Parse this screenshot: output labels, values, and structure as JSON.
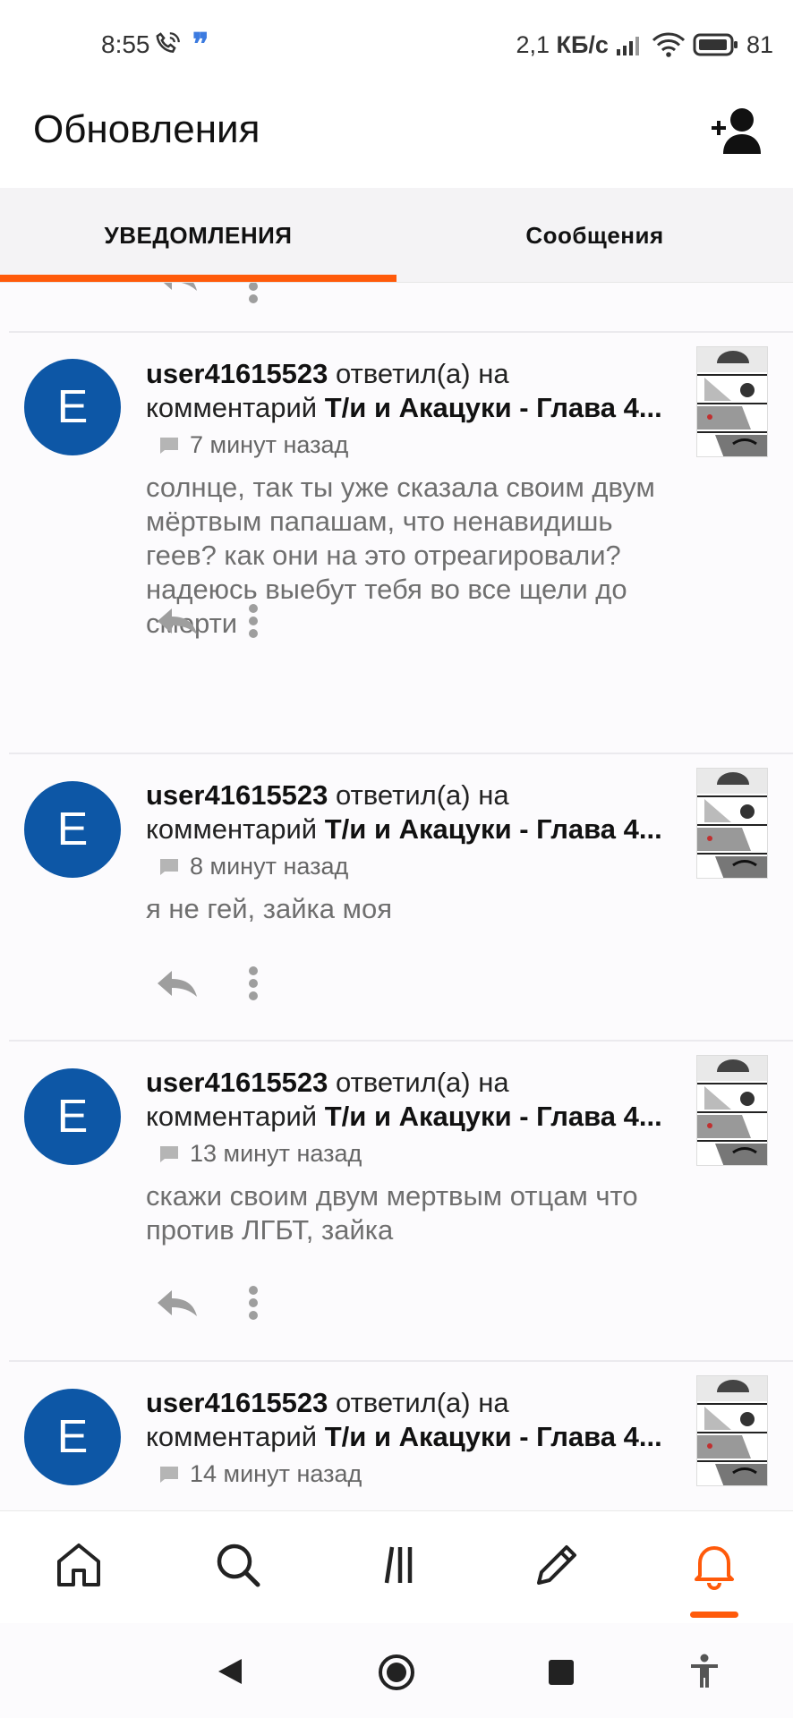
{
  "status_bar": {
    "time": "8:55",
    "network_speed_value": "2,1",
    "network_speed_unit": "КБ/с",
    "battery_percent": "81"
  },
  "header": {
    "title": "Обновления"
  },
  "tabs": [
    {
      "label": "УВЕДОМЛЕНИЯ",
      "active": true
    },
    {
      "label": "Сообщения",
      "active": false
    }
  ],
  "notifications": [
    {
      "avatar_letter": "E",
      "username": "user41615523",
      "action": " ответил(а) на",
      "target_prefix": "комментарий ",
      "story": "Т/и и Акацуки - Глава 4...",
      "time": "7 минут назад",
      "text": "солнце, так ты уже сказала своим двум мёртвым папашам, что ненавидишь геев? как они на это отреагировали? надеюсь выебут тебя во все щели до смерти"
    },
    {
      "avatar_letter": "E",
      "username": "user41615523",
      "action": " ответил(а) на",
      "target_prefix": "комментарий ",
      "story": "Т/и и Акацуки - Глава 4...",
      "time": "8 минут назад",
      "text": "я не гей, зайка моя"
    },
    {
      "avatar_letter": "E",
      "username": "user41615523",
      "action": " ответил(а) на",
      "target_prefix": "комментарий ",
      "story": "Т/и и Акацуки - Глава 4...",
      "time": "13 минут назад",
      "text": "скажи своим двум мертвым отцам что против ЛГБТ, зайка"
    },
    {
      "avatar_letter": "E",
      "username": "user41615523",
      "action": " ответил(а) на",
      "target_prefix": "комментарий ",
      "story": "Т/и и Акацуки - Глава 4...",
      "time": "14 минут назад",
      "text": ""
    }
  ],
  "bottom_nav": [
    {
      "icon": "home-icon",
      "active": false
    },
    {
      "icon": "search-icon",
      "active": false
    },
    {
      "icon": "library-icon",
      "active": false
    },
    {
      "icon": "pencil-icon",
      "active": false
    },
    {
      "icon": "bell-icon",
      "active": true
    }
  ],
  "colors": {
    "accent": "#ff5a0a",
    "avatar": "#0d57a6",
    "muted_text": "#6f6f6f"
  }
}
